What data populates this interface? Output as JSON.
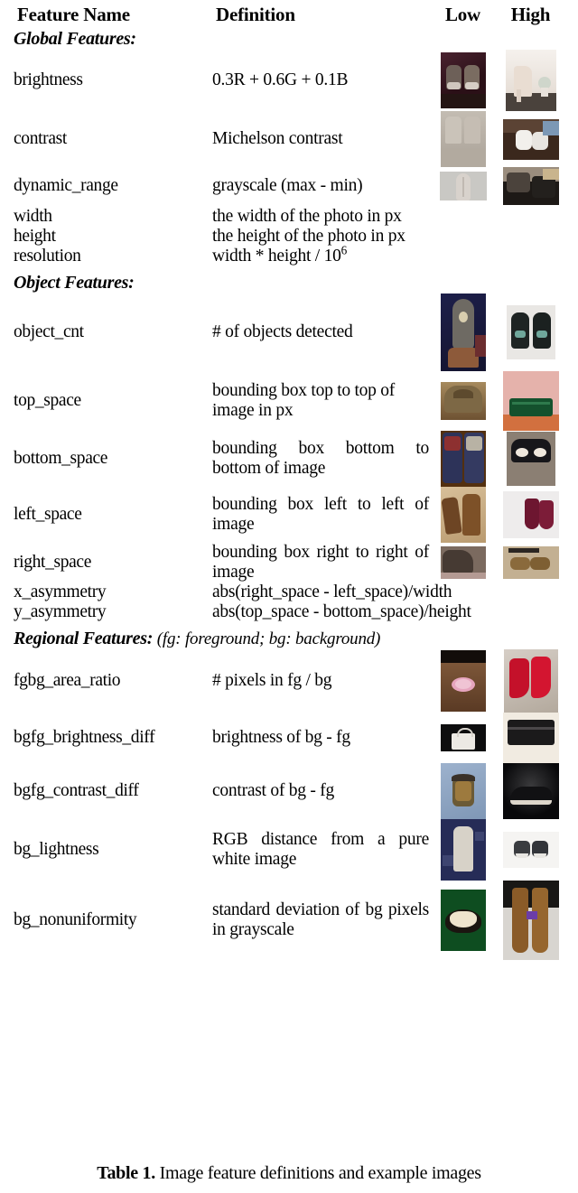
{
  "table": {
    "headers": {
      "feature_name": "Feature Name",
      "definition": "Definition",
      "low": "Low",
      "high": "High"
    },
    "sections": [
      {
        "id": "global",
        "title": "Global Features:",
        "note": "",
        "rows": [
          {
            "name": "brightness",
            "definition": "0.3R + 0.6G + 0.1B",
            "justify": false,
            "low_image": "dark-sneakers-on-maroon-background",
            "high_image": "pale-metallic-bootie-with-plant"
          },
          {
            "name": "contrast",
            "definition": "Michelson contrast",
            "justify": false,
            "low_image": "beige-flat-lit-boots",
            "high_image": "white-sneakers-on-dark-wood"
          },
          {
            "name": "dynamic_range",
            "definition": "grayscale (max - min)",
            "justify": false,
            "low_image": "grey-flat-texture-closeup",
            "high_image": "black-strappy-shoes-pile"
          },
          {
            "name": "width",
            "definition": "the width of the photo in px",
            "justify": false,
            "low_image": "",
            "high_image": ""
          },
          {
            "name": "height",
            "definition": "the height of the photo in px",
            "justify": false,
            "low_image": "",
            "high_image": ""
          },
          {
            "name": "resolution",
            "definition": "width * height / 10",
            "definition_sup": "6",
            "justify": false,
            "low_image": "",
            "high_image": ""
          }
        ]
      },
      {
        "id": "object",
        "title": "Object Features:",
        "note": "",
        "rows": [
          {
            "name": "object_cnt",
            "definition": "# of objects detected",
            "justify": false,
            "low_image": "single-boot-sole-on-navy",
            "high_image": "pair-of-black-sneakers-top-view"
          },
          {
            "name": "top_space",
            "definition": "bounding box top to top of image in px",
            "justify": false,
            "low_image": "brown-bag-filling-frame",
            "high_image": "green-clutch-on-pink-wall"
          },
          {
            "name": "bottom_space",
            "definition": "bounding box bottom to bottom of image",
            "justify": true,
            "low_image": "colorful-sneakers-filling-frame",
            "high_image": "black-sandals-on-grey-carpet"
          },
          {
            "name": "left_space",
            "definition": "bounding box left to left of image",
            "justify": true,
            "low_image": "brown-cowboy-boots-on-paper",
            "high_image": "burgundy-heels-on-white-fabric"
          },
          {
            "name": "right_space",
            "definition": "bounding box right to right of image",
            "justify": true,
            "low_image": "brown-heel-closeup",
            "high_image": "tan-loafers-on-cardboard"
          },
          {
            "name": "x_asymmetry",
            "definition": "abs(right_space - left_space)/width",
            "justify": false,
            "low_image": "",
            "high_image": ""
          },
          {
            "name": "y_asymmetry",
            "definition": "abs(top_space - bottom_space)/height",
            "justify": false,
            "low_image": "",
            "high_image": ""
          }
        ]
      },
      {
        "id": "regional",
        "title": "Regional Features:",
        "note": "(fg: foreground; bg: background)",
        "rows": [
          {
            "name": "fgbg_area_ratio",
            "definition": "# pixels in fg / bg",
            "justify": false,
            "low_image": "small-pink-sandals-on-wood-floor",
            "high_image": "red-heels-on-patterned-clothes"
          },
          {
            "name": "bgfg_brightness_diff",
            "definition": "brightness of bg - fg",
            "justify": false,
            "low_image": "white-handbag-on-black-background",
            "high_image": "black-snakeskin-clutch-on-cream"
          },
          {
            "name": "bgfg_contrast_diff",
            "definition": "contrast of bg - fg",
            "justify": false,
            "low_image": "patterned-backpack-on-blue-cloth",
            "high_image": "black-sneaker-on-dark-gradient"
          },
          {
            "name": "bg_lightness",
            "definition": "RGB distance from a pure white image",
            "justify": true,
            "low_image": "white-boot-on-navy-star-fabric",
            "high_image": "grey-sneakers-on-white-background"
          },
          {
            "name": "bg_nonuniformity",
            "definition": "standard deviation of bg pixels in grayscale",
            "justify": true,
            "low_image": "cream-item-on-green-background",
            "high_image": "tall-brown-cowboy-boots-mixed-bg"
          }
        ]
      }
    ]
  },
  "caption": {
    "label": "Table 1.",
    "text": " Image feature definitions and example images"
  }
}
